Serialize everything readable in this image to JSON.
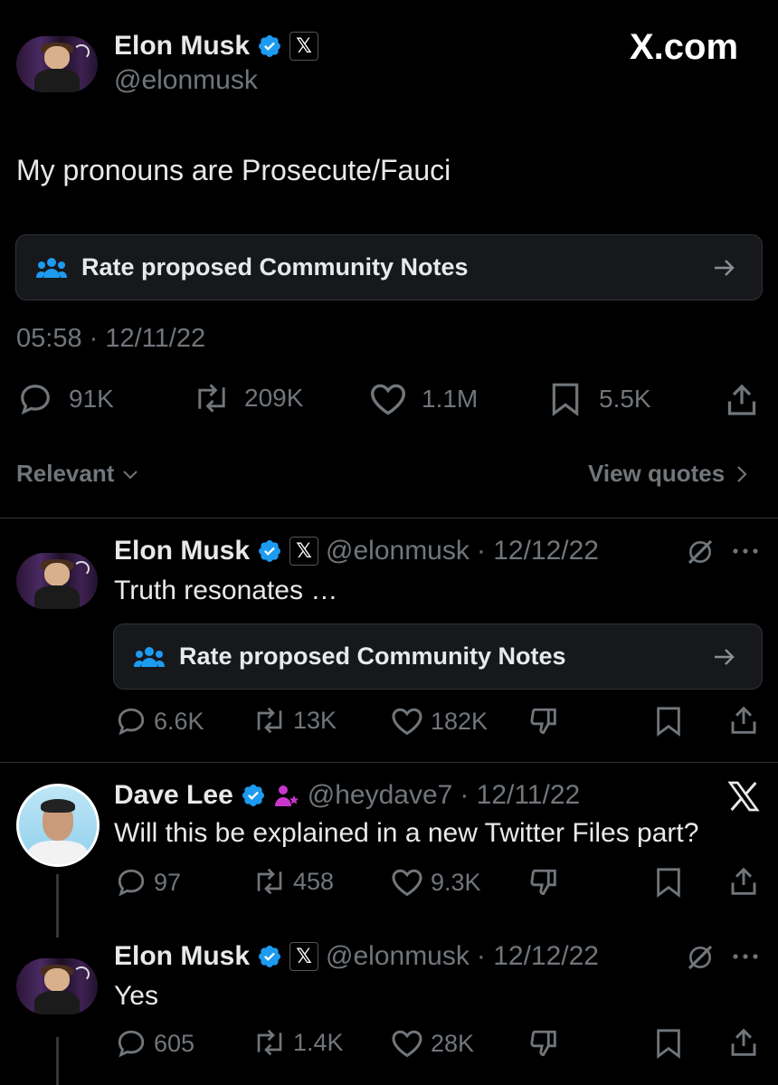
{
  "main_tweet": {
    "author_name": "Elon Musk",
    "author_handle": "@elonmusk",
    "site_label": "X.com",
    "text": "My pronouns are Prosecute/Fauci",
    "community_notes_label": "Rate proposed Community Notes",
    "timestamp": "05:58 · 12/11/22",
    "stats": {
      "replies": "91K",
      "reposts": "209K",
      "likes": "1.1M",
      "bookmarks": "5.5K"
    },
    "sort_label": "Relevant",
    "view_quotes_label": "View quotes"
  },
  "replies": [
    {
      "author_name": "Elon Musk",
      "author_handle": "@elonmusk",
      "date": "· 12/12/22",
      "text": "Truth resonates …",
      "community_notes_label": "Rate proposed Community Notes",
      "stats": {
        "replies": "6.6K",
        "reposts": "13K",
        "likes": "182K"
      }
    },
    {
      "author_name": "Dave Lee",
      "author_handle": "@heydave7",
      "date": "· 12/11/22",
      "text": "Will this be explained in a new Twitter Files part?",
      "stats": {
        "replies": "97",
        "reposts": "458",
        "likes": "9.3K"
      }
    },
    {
      "author_name": "Elon Musk",
      "author_handle": "@elonmusk",
      "date": "· 12/12/22",
      "text": "Yes",
      "stats": {
        "replies": "605",
        "reposts": "1.4K",
        "likes": "28K"
      }
    }
  ],
  "colors": {
    "background": "#000000",
    "text": "#e7e9ea",
    "muted": "#71767b",
    "verified": "#1d9bf0",
    "divider": "#2f3336",
    "note_icon": "#1d9bf0",
    "subscription_icon": "#c936cc"
  },
  "icons": [
    "reply-icon",
    "repost-icon",
    "like-icon",
    "bookmark-icon",
    "share-icon",
    "dislike-icon",
    "grok-icon",
    "more-icon",
    "x-logo-icon",
    "community-notes-icon",
    "verified-icon",
    "chevron-down-icon",
    "chevron-right-icon",
    "arrow-right-icon"
  ]
}
